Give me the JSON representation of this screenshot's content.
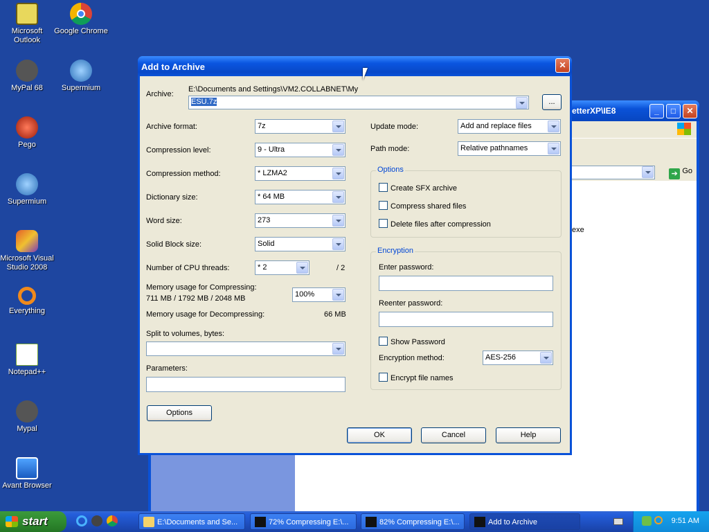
{
  "desktop": {
    "icons": [
      {
        "label": "Microsoft Outlook"
      },
      {
        "label": "Google Chrome"
      },
      {
        "label": "MyPal 68"
      },
      {
        "label": "Supermium"
      },
      {
        "label": "Pego"
      },
      {
        "label": "Supermium"
      },
      {
        "label": "Microsoft Visual Studio 2008"
      },
      {
        "label": "Everything"
      },
      {
        "label": "Notepad++"
      },
      {
        "label": "Mypal"
      },
      {
        "label": "Avant Browser"
      }
    ]
  },
  "background_window": {
    "title": "etterXP\\IE8",
    "go_label": "Go",
    "content_text": "exe"
  },
  "dialog": {
    "title": "Add to Archive",
    "archive_label": "Archive:",
    "archive_path": "E:\\Documents and Settings\\VM2.COLLABNET\\My",
    "archive_name": "ESU.7z",
    "browse_label": "...",
    "archive_format_label": "Archive format:",
    "archive_format_value": "7z",
    "compression_level_label": "Compression level:",
    "compression_level_value": "9 - Ultra",
    "compression_method_label": "Compression method:",
    "compression_method_value": "* LZMA2",
    "dictionary_size_label": "Dictionary size:",
    "dictionary_size_value": "* 64 MB",
    "word_size_label": "Word size:",
    "word_size_value": "273",
    "solid_block_label": "Solid Block size:",
    "solid_block_value": "Solid",
    "cpu_threads_label": "Number of CPU threads:",
    "cpu_threads_value": "* 2",
    "cpu_threads_max": "/ 2",
    "mem_compress_label": "Memory usage for Compressing:",
    "mem_compress_values": "711 MB / 1792 MB / 2048 MB",
    "mem_compress_percent": "100%",
    "mem_decompress_label": "Memory usage for Decompressing:",
    "mem_decompress_value": "66 MB",
    "split_label": "Split to volumes, bytes:",
    "split_value": "",
    "parameters_label": "Parameters:",
    "parameters_value": "",
    "options_button": "Options",
    "update_mode_label": "Update mode:",
    "update_mode_value": "Add and replace files",
    "path_mode_label": "Path mode:",
    "path_mode_value": "Relative pathnames",
    "options_group": "Options",
    "opt_sfx": "Create SFX archive",
    "opt_shared": "Compress shared files",
    "opt_delete": "Delete files after compression",
    "encryption_group": "Encryption",
    "enter_password_label": "Enter password:",
    "reenter_password_label": "Reenter password:",
    "show_password": "Show Password",
    "encryption_method_label": "Encryption method:",
    "encryption_method_value": "AES-256",
    "encrypt_names": "Encrypt file names",
    "ok": "OK",
    "cancel": "Cancel",
    "help": "Help"
  },
  "taskbar": {
    "start": "start",
    "tasks": [
      {
        "label": "E:\\Documents and Se..."
      },
      {
        "label": "72% Compressing E:\\..."
      },
      {
        "label": "82% Compressing E:\\..."
      },
      {
        "label": "Add to Archive"
      }
    ],
    "clock": "9:51 AM"
  },
  "colors": {
    "desktop_bg": "#1e46a0",
    "xp_title_blue": "#0a52d8",
    "dialog_face": "#ece9d8",
    "start_green": "#2f8a2f"
  }
}
